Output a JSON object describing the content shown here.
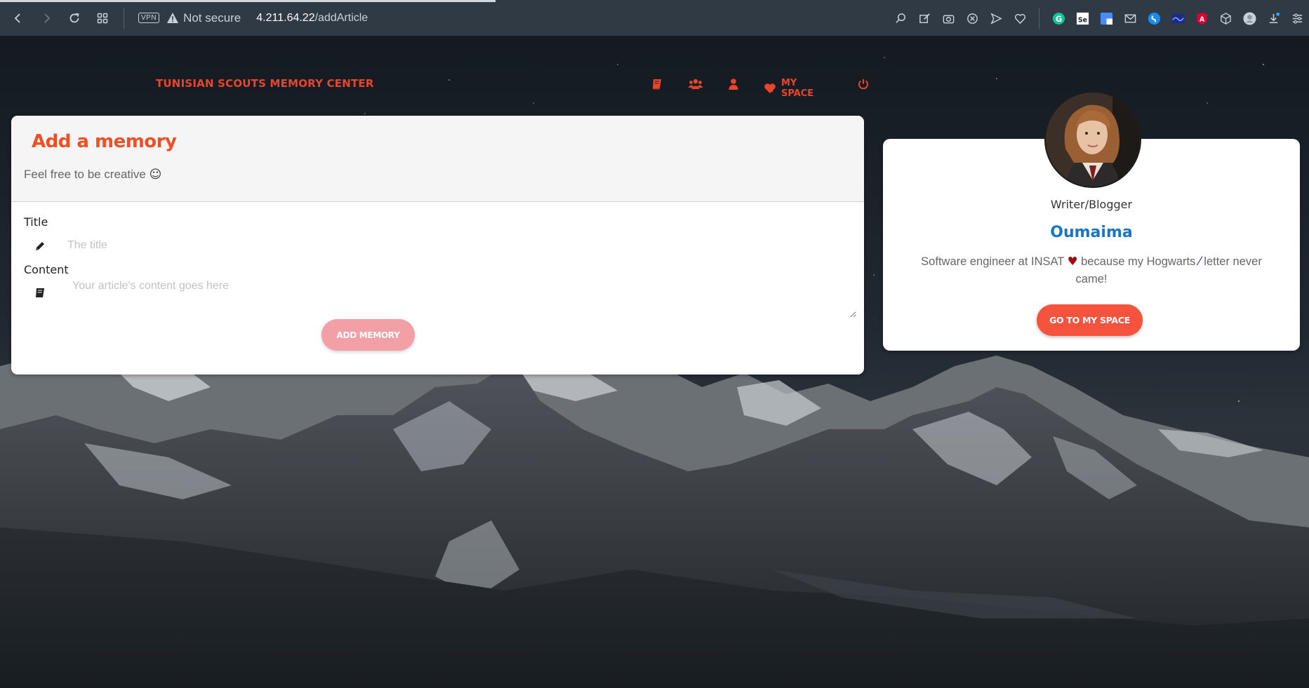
{
  "browser": {
    "vpn_label": "VPN",
    "security_text": "Not secure",
    "url_host": "4.211.64.22",
    "url_path": "/addArticle"
  },
  "navbar": {
    "brand": "TUNISIAN SCOUTS MEMORY CENTER",
    "my_space_label": "MY SPACE",
    "icons": [
      "book-icon",
      "users-icon",
      "user-icon",
      "heart-icon",
      "power-icon"
    ]
  },
  "add_memory": {
    "title": "Add a memory",
    "subtitle": "Feel free to be creative",
    "subtitle_emoji": "☺",
    "title_label": "Title",
    "title_placeholder": "The title",
    "content_label": "Content",
    "content_placeholder": "Your article's content goes here",
    "submit_label": "ADD MEMORY"
  },
  "profile": {
    "role": "Writer/Blogger",
    "name": "Oumaima",
    "bio_part1": "Software engineer at INSAT",
    "bio_heart": "♥",
    "bio_part2": "because my Hogwarts",
    "bio_wand": "⁄",
    "bio_part3": "letter never came!",
    "button_label": "GO TO MY SPACE"
  },
  "colors": {
    "accent": "#e8452c",
    "title_orange": "#f04e23",
    "name_blue": "#1976c2",
    "disabled_button": "#f2a0a6",
    "primary_button": "#f5533d"
  }
}
